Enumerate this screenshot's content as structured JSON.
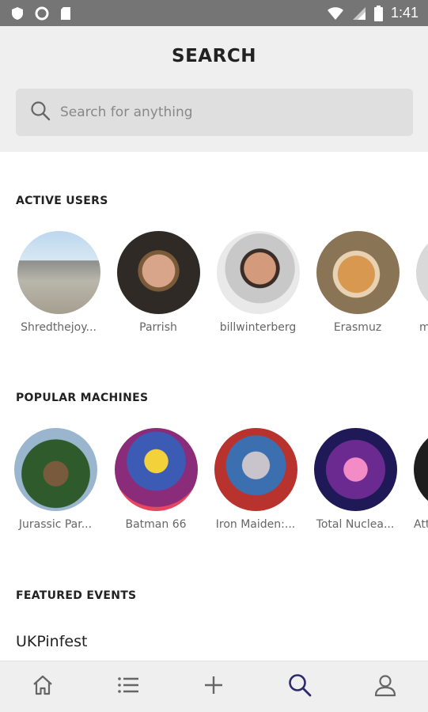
{
  "status_bar": {
    "time": "1:41",
    "icons": [
      "shield-icon",
      "circle-icon",
      "sd-card-icon",
      "wifi-icon",
      "signal-icon",
      "battery-icon"
    ]
  },
  "header": {
    "title": "SEARCH",
    "search_placeholder": "Search for anything"
  },
  "active_users": {
    "title": "ACTIVE USERS",
    "items": [
      {
        "name": "Shredthejoy..."
      },
      {
        "name": "Parrish"
      },
      {
        "name": "billwinterberg"
      },
      {
        "name": "Erasmuz"
      },
      {
        "name": "m"
      }
    ]
  },
  "popular_machines": {
    "title": "POPULAR MACHINES",
    "items": [
      {
        "name": "Jurassic Par..."
      },
      {
        "name": "Batman 66"
      },
      {
        "name": "Iron Maiden:..."
      },
      {
        "name": "Total Nuclea..."
      },
      {
        "name": "Att"
      }
    ]
  },
  "featured_events": {
    "title": "FEATURED EVENTS",
    "items": [
      {
        "name": "UKPinfest"
      }
    ]
  },
  "bottom_nav": {
    "items": [
      "home-icon",
      "list-icon",
      "plus-icon",
      "search-icon",
      "profile-icon"
    ],
    "active": "search-icon",
    "active_color": "#2d2a6e",
    "inactive_color": "#666666"
  }
}
